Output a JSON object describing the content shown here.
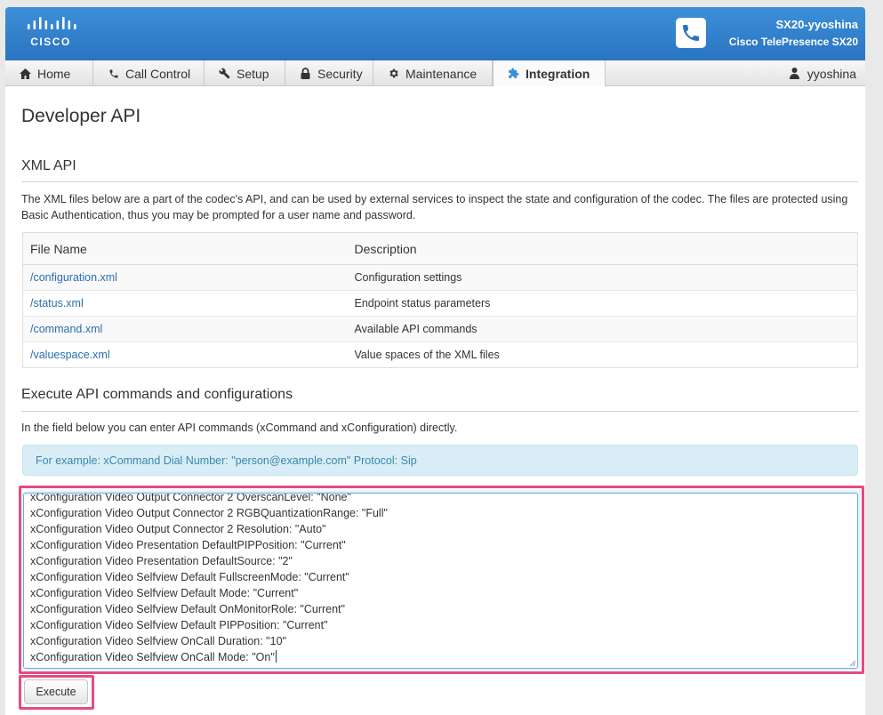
{
  "brand": {
    "logo_text": "CISCO"
  },
  "device": {
    "name": "SX20-yyoshina",
    "model": "Cisco TelePresence SX20"
  },
  "nav": {
    "items": [
      {
        "label": "Home",
        "icon": "home-icon"
      },
      {
        "label": "Call Control",
        "icon": "phone-icon"
      },
      {
        "label": "Setup",
        "icon": "wrench-icon"
      },
      {
        "label": "Security",
        "icon": "lock-icon"
      },
      {
        "label": "Maintenance",
        "icon": "gear-icon"
      },
      {
        "label": "Integration",
        "icon": "puzzle-icon",
        "active": true
      }
    ],
    "user": "yyoshina"
  },
  "page": {
    "title": "Developer API",
    "xml_section": {
      "title": "XML API",
      "description": "The XML files below are a part of the codec's API, and can be used by external services to inspect the state and configuration of the codec. The files are protected using Basic Authentication, thus you may be prompted for a user name and password.",
      "table": {
        "headers": [
          "File Name",
          "Description"
        ],
        "rows": [
          {
            "file": "/configuration.xml",
            "description": "Configuration settings"
          },
          {
            "file": "/status.xml",
            "description": "Endpoint status parameters"
          },
          {
            "file": "/command.xml",
            "description": "Available API commands"
          },
          {
            "file": "/valuespace.xml",
            "description": "Value spaces of the XML files"
          }
        ]
      }
    },
    "execute_section": {
      "title": "Execute API commands and configurations",
      "description": "In the field below you can enter API commands (xCommand and xConfiguration) directly.",
      "example": "For example: xCommand Dial Number: \"person@example.com\" Protocol: Sip",
      "commands": [
        "xConfiguration Video Output Connector 2 OverscanLevel: \"None\"",
        "xConfiguration Video Output Connector 2 RGBQuantizationRange: \"Full\"",
        "xConfiguration Video Output Connector 2 Resolution: \"Auto\"",
        "xConfiguration Video Presentation DefaultPIPPosition: \"Current\"",
        "xConfiguration Video Presentation DefaultSource: \"2\"",
        "xConfiguration Video Selfview Default FullscreenMode: \"Current\"",
        "xConfiguration Video Selfview Default Mode: \"Current\"",
        "xConfiguration Video Selfview Default OnMonitorRole: \"Current\"",
        "xConfiguration Video Selfview Default PIPPosition: \"Current\"",
        "xConfiguration Video Selfview OnCall Duration: \"10\"",
        "xConfiguration Video Selfview OnCall Mode: \"On\""
      ],
      "execute_label": "Execute"
    }
  },
  "colors": {
    "header": "#2a74c0",
    "highlight": "#e84a7f",
    "link": "#2a6db0",
    "alert_bg": "#d9edf7"
  }
}
